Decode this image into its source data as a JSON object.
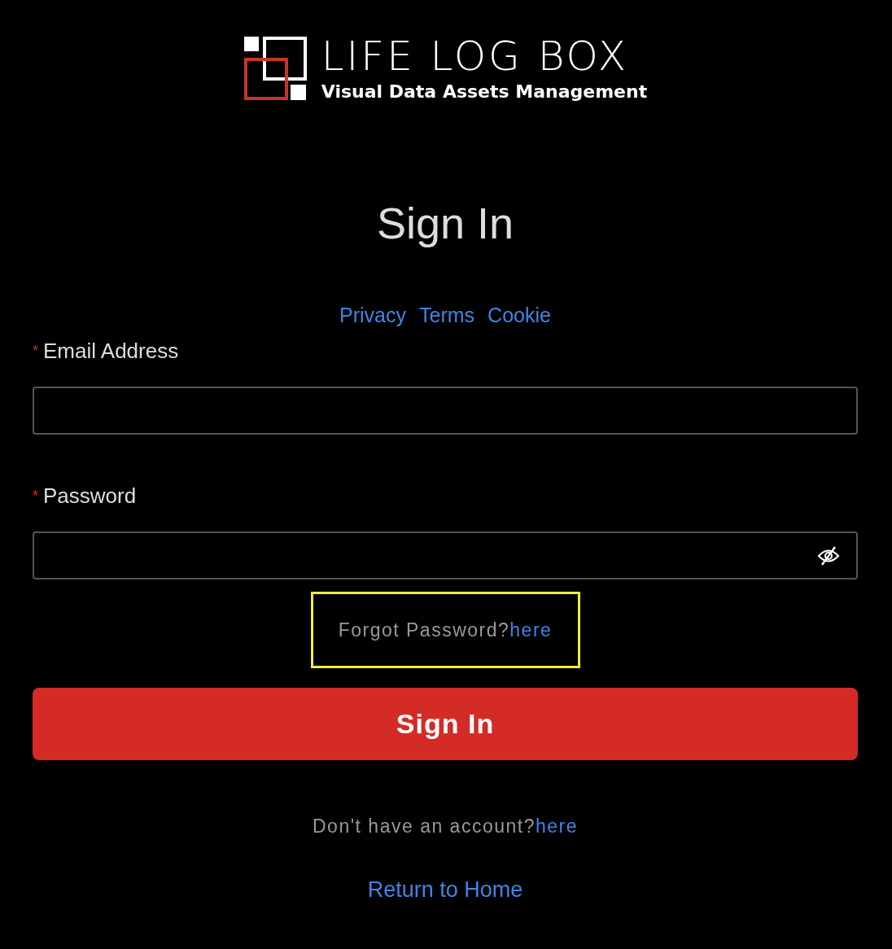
{
  "logo": {
    "title": "LIFE LOG BOX",
    "subtitle": "Visual Data Assets Management"
  },
  "heading": "Sign In",
  "links": [
    "Privacy",
    "Terms",
    "Cookie"
  ],
  "fields": [
    {
      "label": "Email Address",
      "required": true,
      "required_mark": "*",
      "kind": "text"
    },
    {
      "label": "Password",
      "required": true,
      "required_mark": "*",
      "kind": "password",
      "password_visible": false
    }
  ],
  "forgot": {
    "text": "Forgot Password?",
    "link": "here",
    "highlighted": true
  },
  "submit": "Sign In",
  "signup": {
    "text": "Don't have an account?",
    "link": "here"
  },
  "home_link": "Return to Home"
}
